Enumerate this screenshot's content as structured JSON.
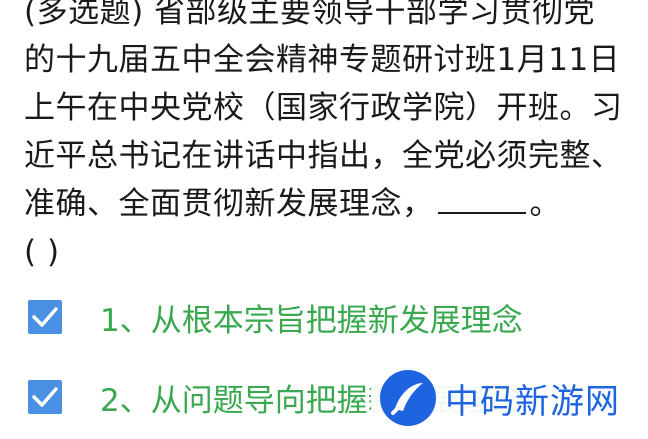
{
  "question": {
    "lines": [
      "(多选题) 省部级主要领导干部学习贯彻党",
      "的十九届五中全会精神专题研讨班1月11日",
      "上午在中央党校（国家行政学院）开班。习",
      "近平总书记在讲话中指出，全党必须完整、",
      "准确、全面贯彻新发展理念，",
      "(    )"
    ],
    "line5_end": "。"
  },
  "options": [
    {
      "label": "1、从根本宗旨把握新发展理念",
      "checked": true
    },
    {
      "label": "2、从问题导向把握新发展理念",
      "checked": true
    }
  ],
  "watermark": {
    "text": "中码新游网",
    "icon": "brand-logo-icon"
  },
  "colors": {
    "checkbox": "#4a90e2",
    "option_text": "#3aa84f",
    "watermark": "#1e63e0"
  }
}
